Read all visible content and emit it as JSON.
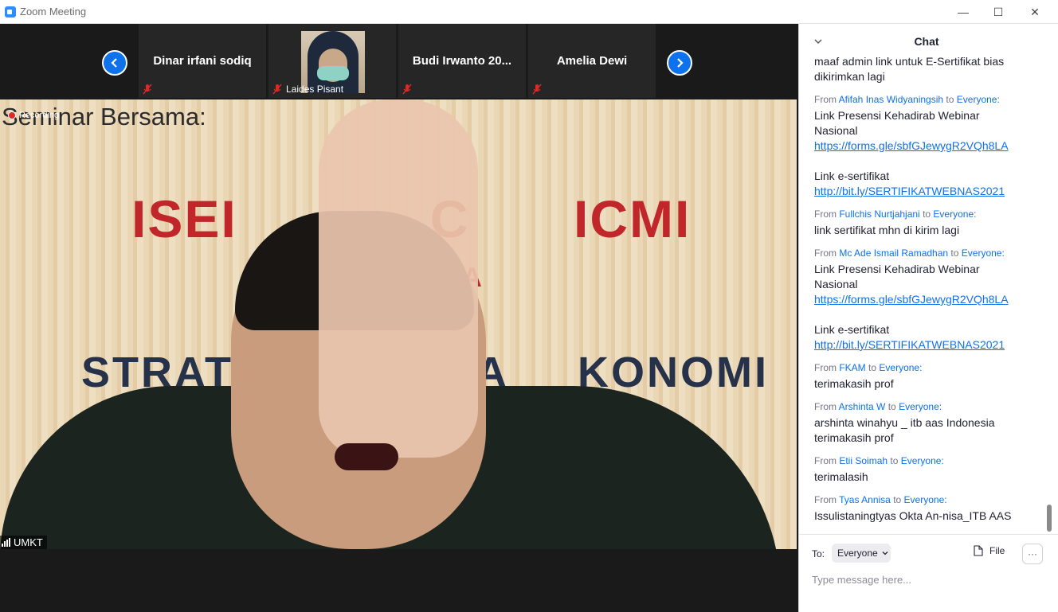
{
  "window": {
    "title": "Zoom Meeting",
    "minimize_glyph": "—",
    "maximize_glyph": "☐",
    "close_glyph": "✕"
  },
  "gallery": {
    "tiles": [
      {
        "name": "Dinar irfani sodiq",
        "muted": true
      },
      {
        "name": "Laides Pisant",
        "muted": true,
        "has_video": true
      },
      {
        "name": "Budi Irwanto 20...",
        "muted": true
      },
      {
        "name": "Amelia Dewi",
        "muted": true
      }
    ]
  },
  "video": {
    "recording_label": "Recording",
    "speaker_name": "UMKT",
    "slide": {
      "title": "Seminar Bersama:",
      "left_org": "ISEI",
      "middle_fragment_1": "C",
      "middle_fragment_2": "TA",
      "right_org": "ICMI",
      "line_left": "STRATE",
      "line_mid": "HA",
      "line_right": "KONOMI"
    }
  },
  "chat": {
    "title": "Chat",
    "from_word": "From",
    "to_word": "to",
    "messages": [
      {
        "sender": "",
        "recipient": "",
        "lines": [
          "maaf admin link untuk E-Sertifikat bias",
          "dikirimkan lagi"
        ],
        "links": []
      },
      {
        "sender": "Afifah Inas Widyaningsih",
        "recipient": "Everyone:",
        "lines": [
          "Link Presensi Kehadirab Webinar",
          "Nasional"
        ],
        "links": [
          "https://forms.gle/sbfGJewygR2VQh8LA"
        ],
        "extra_line": "Link e-sertifikat",
        "extra_link": "http://bit.ly/SERTIFIKATWEBNAS2021"
      },
      {
        "sender": "Fullchis Nurtjahjani",
        "recipient": "Everyone:",
        "lines": [
          "link sertifikat mhn di kirim lagi"
        ],
        "links": []
      },
      {
        "sender": "Mc Ade Ismail Ramadhan",
        "recipient": "Everyone:",
        "lines": [
          "Link Presensi Kehadirab Webinar",
          "Nasional"
        ],
        "links": [
          "https://forms.gle/sbfGJewygR2VQh8LA"
        ],
        "extra_line": "Link e-sertifikat",
        "extra_link": "http://bit.ly/SERTIFIKATWEBNAS2021"
      },
      {
        "sender": "FKAM",
        "recipient": "Everyone:",
        "lines": [
          "terimakasih prof"
        ],
        "links": []
      },
      {
        "sender": "Arshinta W",
        "recipient": "Everyone:",
        "lines": [
          "arshinta winahyu _ itb aas Indonesia",
          "terimakasih prof"
        ],
        "links": []
      },
      {
        "sender": "Etii Soimah",
        "recipient": "Everyone:",
        "lines": [
          "terimalasih"
        ],
        "links": []
      },
      {
        "sender": "Tyas Annisa",
        "recipient": "Everyone:",
        "lines": [
          "Issulistaningtyas Okta An-nisa_ITB AAS"
        ],
        "links": []
      }
    ],
    "footer": {
      "to_label": "To:",
      "recipient": "Everyone",
      "file_label": "File",
      "more_label": "···",
      "input_placeholder": "Type message here..."
    }
  }
}
